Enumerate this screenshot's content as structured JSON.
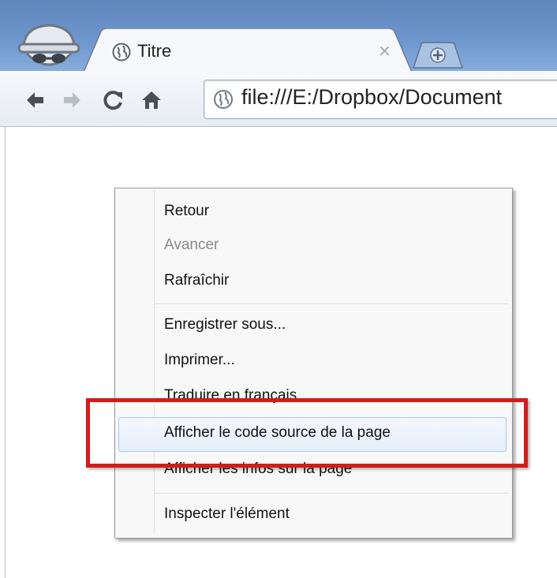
{
  "browser": {
    "tab": {
      "title": "Titre",
      "close_symbol": "×"
    },
    "address_bar": {
      "url": "file:///E:/Dropbox/Document"
    }
  },
  "context_menu": {
    "groups": [
      [
        {
          "label": "Retour",
          "enabled": true
        },
        {
          "label": "Avancer",
          "enabled": false
        },
        {
          "label": "Rafraîchir",
          "enabled": true
        }
      ],
      [
        {
          "label": "Enregistrer sous...",
          "enabled": true
        },
        {
          "label": "Imprimer...",
          "enabled": true
        },
        {
          "label": "Traduire en français",
          "enabled": true
        },
        {
          "label": "Afficher le code source de la page",
          "enabled": true,
          "hovered": true
        },
        {
          "label": "Afficher les infos sur la page",
          "enabled": true
        }
      ],
      [
        {
          "label": "Inspecter l'élément",
          "enabled": true
        }
      ]
    ]
  },
  "annotation": {
    "highlight_color": "#d31c1c"
  }
}
